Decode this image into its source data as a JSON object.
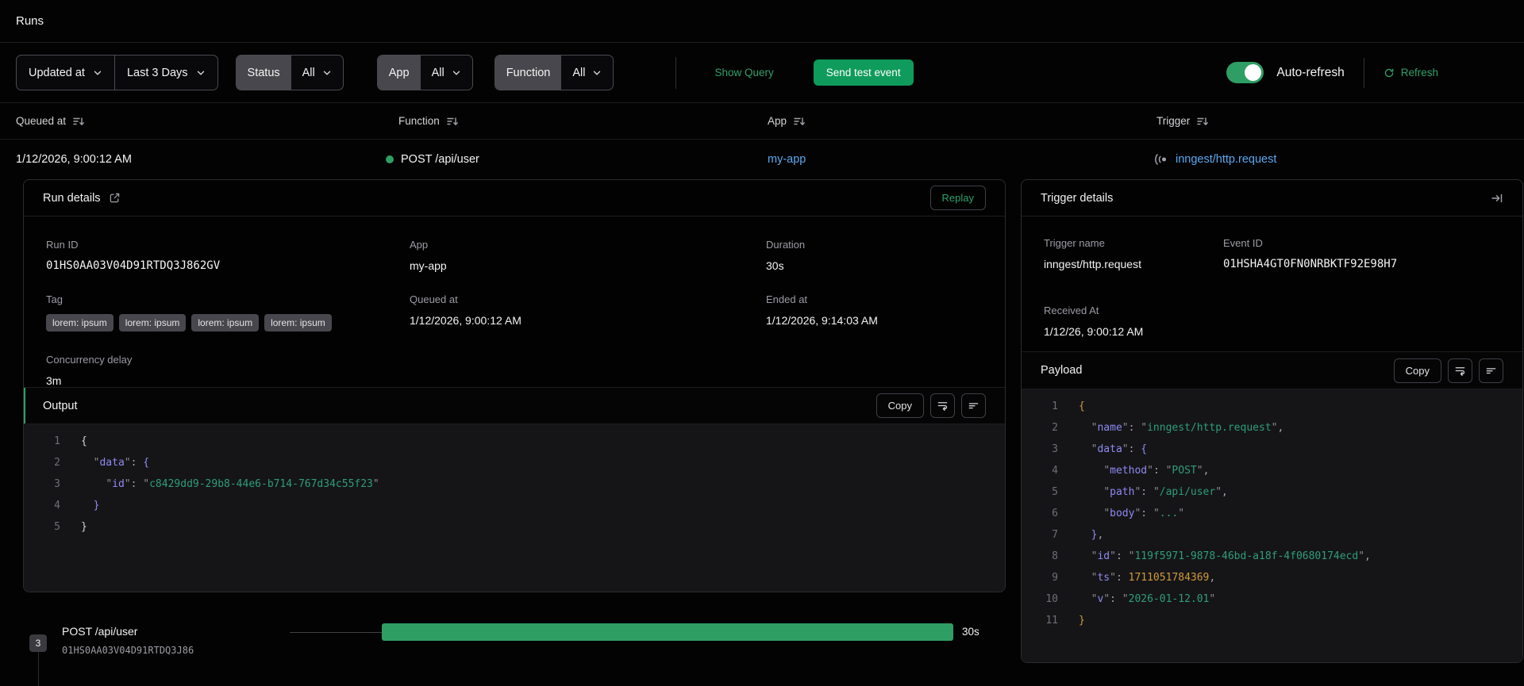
{
  "page": {
    "title": "Runs"
  },
  "colors": {
    "accent_green": "#2f9e64",
    "button_green": "#0f9b5b",
    "link_blue": "#5aa9f0",
    "status_dot_green": "#2f9e63",
    "timeline_bar_green": "#2f9e63"
  },
  "filter_bar": {
    "time_field": {
      "label": "Updated at"
    },
    "time_range": {
      "label": "Last 3 Days"
    },
    "status_filter": {
      "label": "Status",
      "value": "All"
    },
    "app_filter": {
      "label": "App",
      "value": "All"
    },
    "function_filter": {
      "label": "Function",
      "value": "All"
    },
    "show_query": "Show Query",
    "send_test_event": "Send test event",
    "auto_refresh": "Auto-refresh",
    "refresh": "Refresh"
  },
  "table": {
    "columns": {
      "queued_at": "Queued at",
      "function": "Function",
      "app": "App",
      "trigger": "Trigger"
    },
    "row": {
      "queued_at": "1/12/2026, 9:00:12 AM",
      "function": "POST /api/user",
      "app": "my-app",
      "trigger": "inngest/http.request"
    }
  },
  "run_details": {
    "title": "Run details",
    "replay": "Replay",
    "run_id": {
      "label": "Run ID",
      "value": "01HS0AA03V04D91RTDQ3J862GV"
    },
    "app": {
      "label": "App",
      "value": "my-app"
    },
    "duration": {
      "label": "Duration",
      "value": "30s"
    },
    "tag": {
      "label": "Tag",
      "values": [
        "lorem: ipsum",
        "lorem: ipsum",
        "lorem: ipsum",
        "lorem: ipsum"
      ]
    },
    "queued_at": {
      "label": "Queued at",
      "value": "1/12/2026, 9:00:12 AM"
    },
    "ended_at": {
      "label": "Ended at",
      "value": "1/12/2026, 9:14:03 AM"
    },
    "concurrency_delay": {
      "label": "Concurrency delay",
      "value": "3m"
    }
  },
  "output": {
    "title": "Output",
    "copy": "Copy",
    "lines": [
      [
        [
          "{",
          "bg0"
        ]
      ],
      [
        [
          "  ",
          ""
        ],
        [
          "\"",
          "qt"
        ],
        [
          "data",
          "key"
        ],
        [
          "\"",
          "qt"
        ],
        [
          ":",
          "pun"
        ],
        [
          " ",
          ""
        ],
        [
          "{",
          "bi"
        ]
      ],
      [
        [
          "    ",
          ""
        ],
        [
          "\"",
          "qt"
        ],
        [
          "id",
          "key"
        ],
        [
          "\"",
          "qt"
        ],
        [
          ":",
          "pun"
        ],
        [
          " ",
          ""
        ],
        [
          "\"",
          "qt"
        ],
        [
          "c8429dd9-29b8-44e6-b714-767d34c55f23",
          "str"
        ],
        [
          "\"",
          "qt"
        ]
      ],
      [
        [
          "  ",
          ""
        ],
        [
          "}",
          "bi"
        ]
      ],
      [
        [
          "}",
          "bg0"
        ]
      ]
    ]
  },
  "trigger_details": {
    "title": "Trigger details",
    "trigger_name": {
      "label": "Trigger name",
      "value": "inngest/http.request"
    },
    "event_id": {
      "label": "Event ID",
      "value": "01HSHA4GT0FN0NRBKTF92E98H7"
    },
    "received_at": {
      "label": "Received At",
      "value": "1/12/26, 9:00:12 AM"
    }
  },
  "payload": {
    "title": "Payload",
    "copy": "Copy",
    "lines": [
      [
        [
          "{",
          "bo"
        ]
      ],
      [
        [
          "  ",
          ""
        ],
        [
          "\"",
          "qt"
        ],
        [
          "name",
          "key"
        ],
        [
          "\"",
          "qt"
        ],
        [
          ":",
          "pun"
        ],
        [
          " ",
          ""
        ],
        [
          "\"",
          "qt"
        ],
        [
          "inngest/http.request",
          "str"
        ],
        [
          "\"",
          "qt"
        ],
        [
          ",",
          "pun"
        ]
      ],
      [
        [
          "  ",
          ""
        ],
        [
          "\"",
          "qt"
        ],
        [
          "data",
          "key"
        ],
        [
          "\"",
          "qt"
        ],
        [
          ":",
          "pun"
        ],
        [
          " ",
          ""
        ],
        [
          "{",
          "bi"
        ]
      ],
      [
        [
          "    ",
          ""
        ],
        [
          "\"",
          "qt"
        ],
        [
          "method",
          "key"
        ],
        [
          "\"",
          "qt"
        ],
        [
          ":",
          "pun"
        ],
        [
          " ",
          ""
        ],
        [
          "\"",
          "qt"
        ],
        [
          "POST",
          "str"
        ],
        [
          "\"",
          "qt"
        ],
        [
          ",",
          "pun"
        ]
      ],
      [
        [
          "    ",
          ""
        ],
        [
          "\"",
          "qt"
        ],
        [
          "path",
          "key"
        ],
        [
          "\"",
          "qt"
        ],
        [
          ":",
          "pun"
        ],
        [
          " ",
          ""
        ],
        [
          "\"",
          "qt"
        ],
        [
          "/api/user",
          "str"
        ],
        [
          "\"",
          "qt"
        ],
        [
          ",",
          "pun"
        ]
      ],
      [
        [
          "    ",
          ""
        ],
        [
          "\"",
          "qt"
        ],
        [
          "body",
          "key"
        ],
        [
          "\"",
          "qt"
        ],
        [
          ":",
          "pun"
        ],
        [
          " ",
          ""
        ],
        [
          "\"",
          "qt"
        ],
        [
          "...",
          "str"
        ],
        [
          "\"",
          "qt"
        ]
      ],
      [
        [
          "  ",
          ""
        ],
        [
          "}",
          "bi"
        ],
        [
          ",",
          "pun"
        ]
      ],
      [
        [
          "  ",
          ""
        ],
        [
          "\"",
          "qt"
        ],
        [
          "id",
          "key"
        ],
        [
          "\"",
          "qt"
        ],
        [
          ":",
          "pun"
        ],
        [
          " ",
          ""
        ],
        [
          "\"",
          "qt"
        ],
        [
          "119f5971-9878-46bd-a18f-4f0680174ecd",
          "str"
        ],
        [
          "\"",
          "qt"
        ],
        [
          ",",
          "pun"
        ]
      ],
      [
        [
          "  ",
          ""
        ],
        [
          "\"",
          "qt"
        ],
        [
          "ts",
          "key"
        ],
        [
          "\"",
          "qt"
        ],
        [
          ":",
          "pun"
        ],
        [
          " ",
          ""
        ],
        [
          "1711051784369",
          "num"
        ],
        [
          ",",
          "pun"
        ]
      ],
      [
        [
          "  ",
          ""
        ],
        [
          "\"",
          "qt"
        ],
        [
          "v",
          "key"
        ],
        [
          "\"",
          "qt"
        ],
        [
          ":",
          "pun"
        ],
        [
          " ",
          ""
        ],
        [
          "\"",
          "qt"
        ],
        [
          "2026-01-12.01",
          "str"
        ],
        [
          "\"",
          "qt"
        ]
      ],
      [
        [
          "}",
          "bo"
        ]
      ]
    ]
  },
  "timeline": {
    "step_number": "3",
    "function_name": "POST /api/user",
    "run_id": "01HS0AA03V04D91RTDQ3J86",
    "duration": "30s"
  }
}
